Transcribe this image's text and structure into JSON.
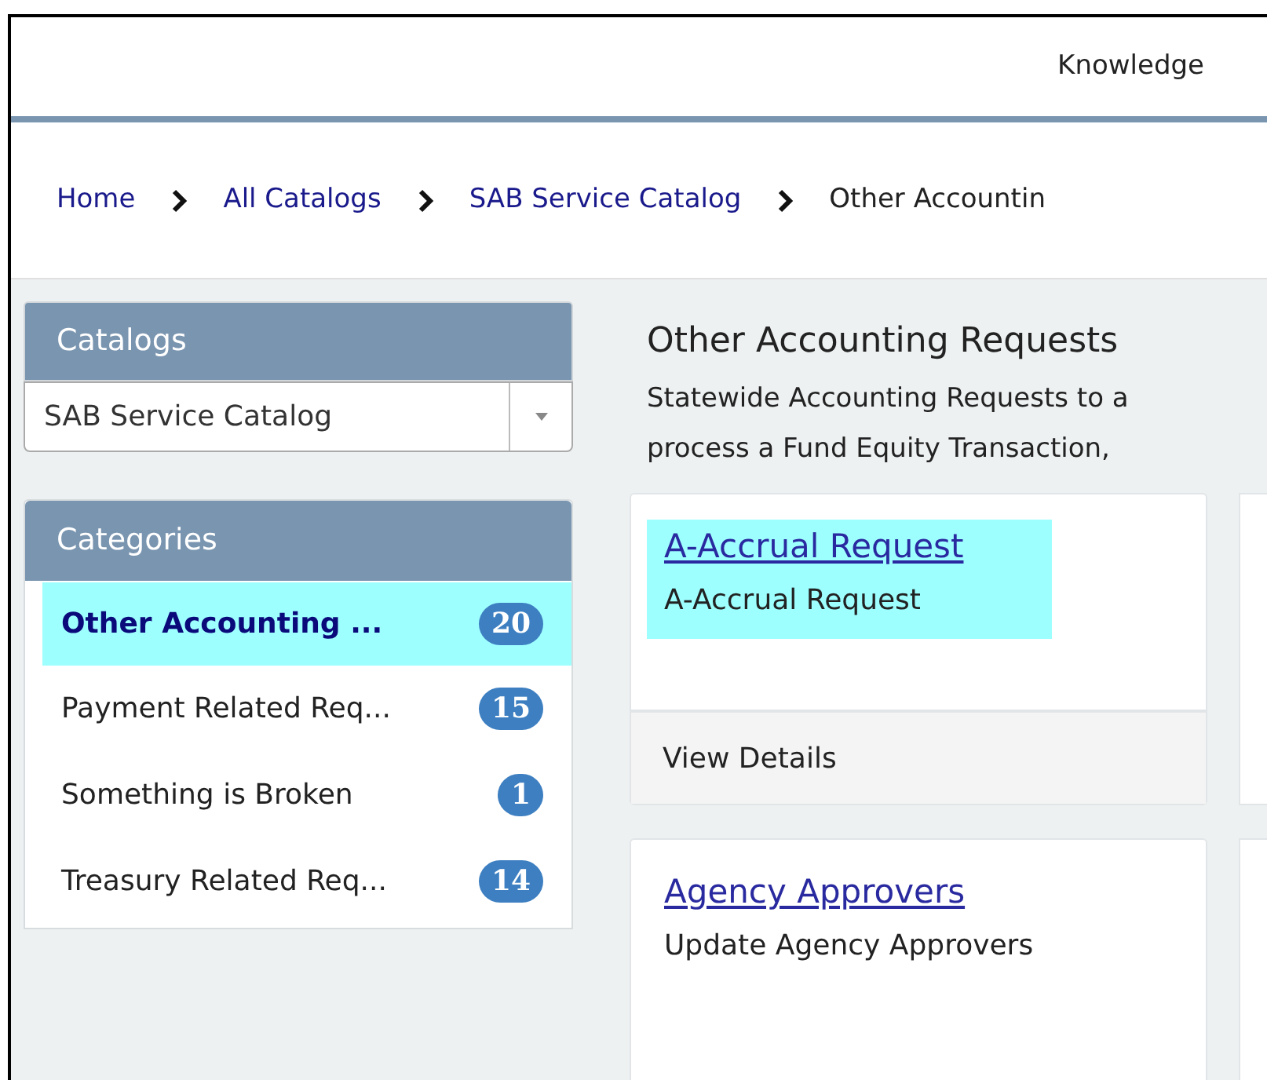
{
  "header": {
    "nav_link": "Knowledge"
  },
  "breadcrumb": [
    {
      "label": "Home",
      "kind": "link"
    },
    {
      "label": "All Catalogs",
      "kind": "link"
    },
    {
      "label": "SAB Service Catalog",
      "kind": "link"
    },
    {
      "label": "Other Accountin",
      "kind": "current"
    }
  ],
  "catalogs": {
    "title": "Catalogs",
    "select_value": "SAB Service Catalog"
  },
  "categories": {
    "title": "Categories",
    "items": [
      {
        "label": "Other Accounting ...",
        "count": "20",
        "selected": true
      },
      {
        "label": "Payment Related Req...",
        "count": "15",
        "selected": false
      },
      {
        "label": "Something is Broken",
        "count": "1",
        "selected": false
      },
      {
        "label": "Treasury Related Req...",
        "count": "14",
        "selected": false
      }
    ]
  },
  "main": {
    "title": "Other Accounting Requests",
    "description_lines": [
      "Statewide Accounting Requests to a",
      "process a Fund Equity Transaction,"
    ],
    "cards": [
      {
        "title": "A-Accrual Request",
        "description": "A-Accrual Request",
        "highlighted": true,
        "footer": "View Details"
      },
      {
        "title": "Agency Approvers",
        "description": "Update Agency Approvers",
        "highlighted": false
      }
    ]
  }
}
